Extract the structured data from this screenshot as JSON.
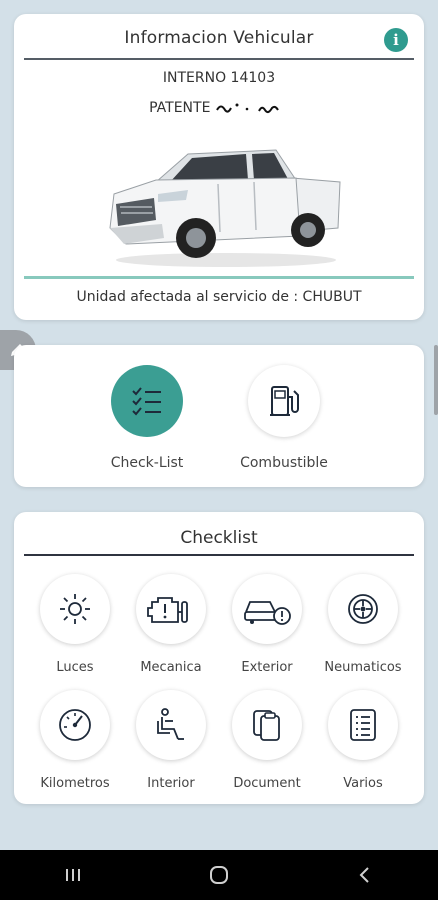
{
  "vehicle_card": {
    "title": "Informacion Vehicular",
    "info_icon": "info-icon",
    "interno": "INTERNO 14103",
    "patente_label": "PATENTE",
    "unidad_text": "Unidad afectada al servicio de :  CHUBUT"
  },
  "actions": [
    {
      "label": "Check-List",
      "icon": "checklist-icon",
      "selected": true
    },
    {
      "label": "Combustible",
      "icon": "fuel-pump-icon",
      "selected": false
    }
  ],
  "checklist": {
    "title": "Checklist",
    "items": [
      {
        "label": "Luces",
        "icon": "light-icon"
      },
      {
        "label": "Mecanica",
        "icon": "engine-icon"
      },
      {
        "label": "Exterior",
        "icon": "car-alert-icon"
      },
      {
        "label": "Neumaticos",
        "icon": "tire-icon"
      },
      {
        "label": "Kilometros",
        "icon": "speedometer-icon"
      },
      {
        "label": "Interior",
        "icon": "seat-icon"
      },
      {
        "label": "Document",
        "icon": "documents-icon"
      },
      {
        "label": "Varios",
        "icon": "list-icon"
      }
    ]
  },
  "colors": {
    "accent": "#3b9e93",
    "background": "#d3e0e8",
    "teal_rule": "#88c9bd"
  },
  "navigation": {
    "recent": "recent-apps-icon",
    "home": "home-icon",
    "back": "back-icon"
  }
}
